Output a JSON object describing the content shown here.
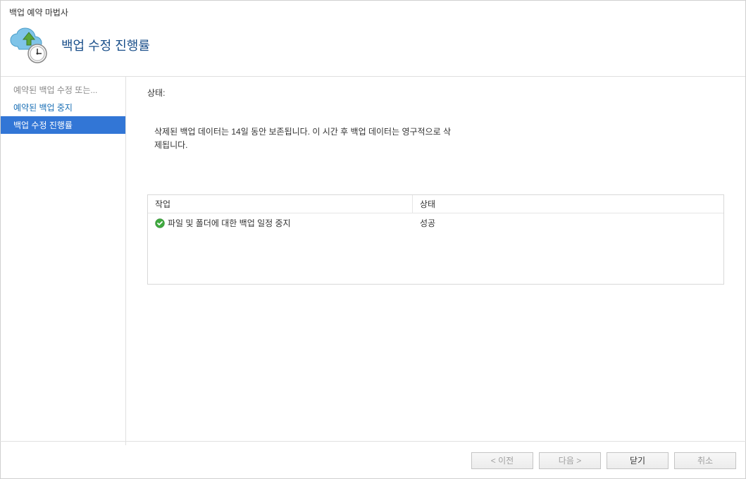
{
  "window": {
    "title": "백업 예약 마법사"
  },
  "header": {
    "title": "백업 수정 진행률"
  },
  "sidebar": {
    "items": [
      {
        "label": "예약된 백업 수정 또는...",
        "state": "disabled"
      },
      {
        "label": "예약된 백업 중지",
        "state": "normal"
      },
      {
        "label": "백업 수정 진행률",
        "state": "active"
      }
    ]
  },
  "main": {
    "status_label": "상태:",
    "status_message": "삭제된 백업 데이터는 14일 동안 보존됩니다. 이 시간 후 백업 데이터는 영구적으로 삭제됩니다.",
    "table": {
      "headers": {
        "task": "작업",
        "status": "상태"
      },
      "rows": [
        {
          "task": "파일 및 폴더에 대한 백업 일정 중지",
          "status": "성공",
          "icon": "success"
        }
      ]
    }
  },
  "buttons": {
    "previous": "< 이전",
    "next": "다음 >",
    "close": "닫기",
    "cancel": "취소"
  }
}
